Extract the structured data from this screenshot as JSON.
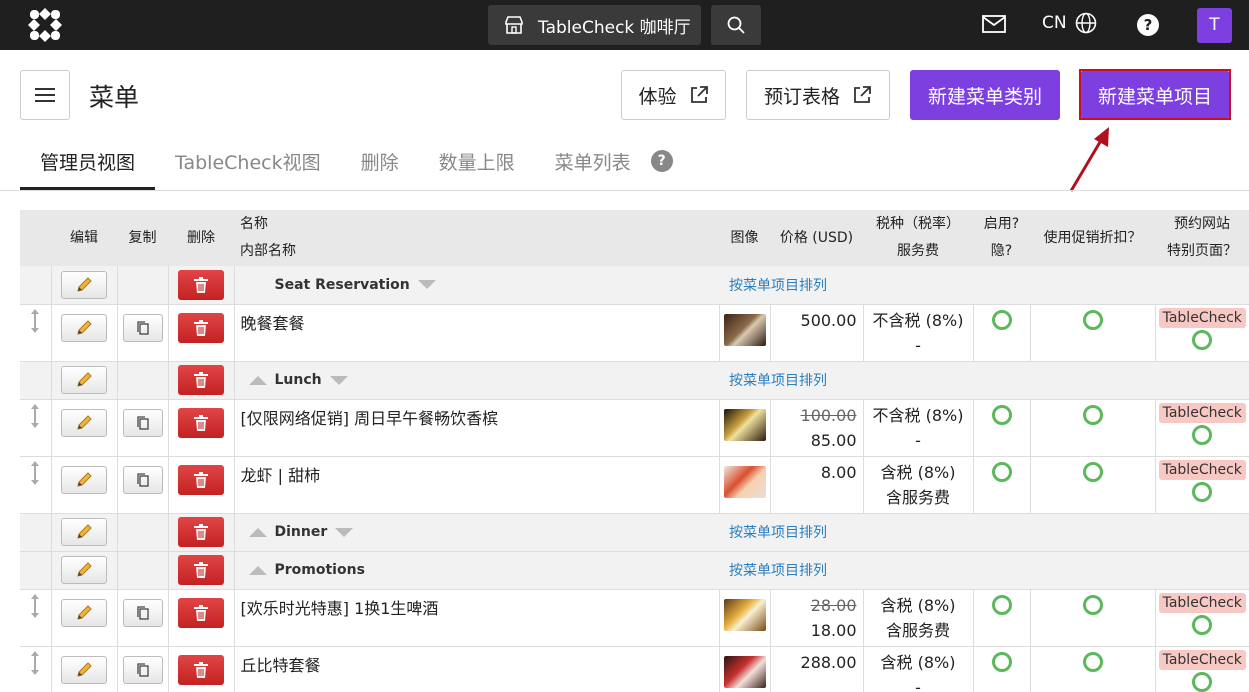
{
  "topbar": {
    "venue_name": "TableCheck 咖啡厅",
    "lang": "CN",
    "avatar_initial": "T"
  },
  "header": {
    "title": "菜单",
    "btn_experience": "体验",
    "btn_booking_form": "预订表格",
    "btn_new_category": "新建菜单类别",
    "btn_new_item": "新建菜单项目"
  },
  "tabs": [
    "管理员视图",
    "TableCheck视图",
    "删除",
    "数量上限",
    "菜单列表"
  ],
  "table": {
    "headers": {
      "edit": "编辑",
      "copy": "复制",
      "delete": "删除",
      "name": "名称",
      "internal_name": "内部名称",
      "image": "图像",
      "price": "价格 (USD)",
      "tax": "税种（税率）",
      "service": "服务费",
      "enabled": "启用?",
      "hidden": "隐?",
      "promo": "使用促销折扣？",
      "site": "预约网站",
      "special": "特别页面？"
    },
    "sort_label": "按菜单项目排列",
    "categories": [
      {
        "name": "Seat Reservation",
        "items": [
          {
            "name": "晚餐套餐",
            "price": "500.00",
            "old_price": "",
            "tax": "不含税 (8%)",
            "service": "-",
            "badge": "TableCheck"
          }
        ]
      },
      {
        "name": "Lunch",
        "items": [
          {
            "name": "[仅限网络促销] 周日早午餐畅饮香槟",
            "price": "85.00",
            "old_price": "100.00",
            "tax": "不含税 (8%)",
            "service": "-",
            "badge": "TableCheck"
          },
          {
            "name": "龙虾 | 甜柿",
            "price": "8.00",
            "old_price": "",
            "tax": "含税 (8%)",
            "service": "含服务费",
            "badge": "TableCheck"
          }
        ]
      },
      {
        "name": "Dinner",
        "items": []
      },
      {
        "name": "Promotions",
        "items": [
          {
            "name": "[欢乐时光特惠] 1换1生啤酒",
            "price": "18.00",
            "old_price": "28.00",
            "tax": "含税 (8%)",
            "service": "含服务费",
            "badge": "TableCheck"
          },
          {
            "name": "丘比特套餐",
            "price": "288.00",
            "old_price": "",
            "tax": "含税 (8%)",
            "service": "-",
            "badge": "TableCheck"
          }
        ]
      }
    ]
  },
  "colors": {
    "primary": "#7d3fe0",
    "topbar": "#1f1f1f",
    "highlight": "#c81020",
    "delete": "#d33333",
    "ok": "#5cb85c"
  }
}
